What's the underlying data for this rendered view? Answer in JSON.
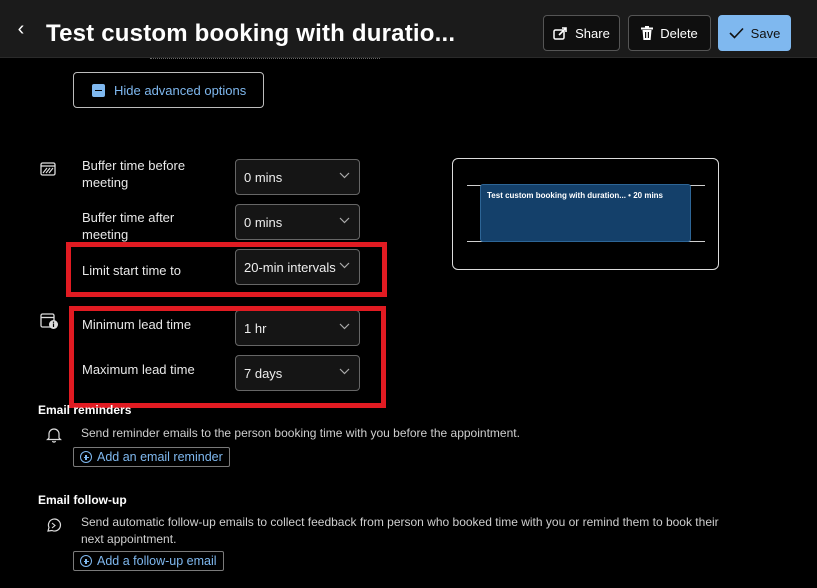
{
  "header": {
    "title": "Test custom booking with duratio...",
    "share_label": "Share",
    "delete_label": "Delete",
    "save_label": "Save"
  },
  "advanced": {
    "hide_label": "Hide advanced options"
  },
  "buffer_before": {
    "label": "Buffer time before meeting",
    "value": "0 mins"
  },
  "buffer_after": {
    "label": "Buffer time after meeting",
    "value": "0 mins"
  },
  "limit_start": {
    "label": "Limit start time to",
    "value": "20-min intervals"
  },
  "min_lead": {
    "label": "Minimum lead time",
    "value": "1 hr"
  },
  "max_lead": {
    "label": "Maximum lead time",
    "value": "7 days"
  },
  "preview": {
    "event_text": "Test custom booking with duration... • 20 mins"
  },
  "email_reminders": {
    "heading": "Email reminders",
    "description": "Send reminder emails to the person booking time with you before the appointment.",
    "add_label": "Add an email reminder"
  },
  "email_followup": {
    "heading": "Email follow-up",
    "description_line1": "Send automatic follow-up emails to collect feedback from person who booked time with you or remind them to book their",
    "description_line2": "next appointment.",
    "add_label": "Add a follow-up email"
  },
  "colors": {
    "accent": "#7fb8ef",
    "highlight": "#e11b22",
    "event_bg": "#14406a"
  }
}
